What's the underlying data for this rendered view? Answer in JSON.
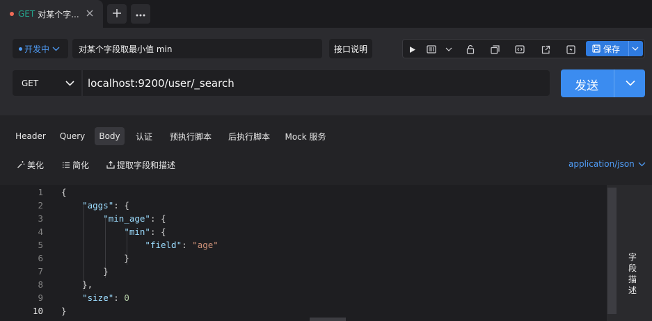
{
  "tab": {
    "method": "GET",
    "title": "对某个字...",
    "method_color": "#25a38c",
    "dot_color": "#f06b57"
  },
  "env": {
    "label": "开发中",
    "color": "#4f9cf6"
  },
  "request": {
    "name": "对某个字段取最小值 min",
    "doc_label": "接口说明",
    "save_label": "保存",
    "method": "GET",
    "url": "localhost:9200/user/_search",
    "send_label": "发送"
  },
  "subtabs": [
    "Header",
    "Query",
    "Body",
    "认证",
    "预执行脚本",
    "后执行脚本",
    "Mock 服务"
  ],
  "active_subtab": "Body",
  "body_tools": {
    "beautify": "美化",
    "simplify": "简化",
    "extract": "提取字段和描述",
    "content_type": "application/json"
  },
  "editor": {
    "line_numbers": [
      "1",
      "2",
      "3",
      "4",
      "5",
      "6",
      "7",
      "8",
      "9",
      "10"
    ],
    "current_line": "10",
    "lines": [
      [
        {
          "t": "p",
          "v": "{"
        }
      ],
      [
        {
          "t": "p",
          "v": "    "
        },
        {
          "t": "k",
          "v": "\"aggs\""
        },
        {
          "t": "p",
          "v": ": {"
        }
      ],
      [
        {
          "t": "p",
          "v": "        "
        },
        {
          "t": "k",
          "v": "\"min_age\""
        },
        {
          "t": "p",
          "v": ": {"
        }
      ],
      [
        {
          "t": "p",
          "v": "            "
        },
        {
          "t": "k",
          "v": "\"min\""
        },
        {
          "t": "p",
          "v": ": {"
        }
      ],
      [
        {
          "t": "p",
          "v": "                "
        },
        {
          "t": "k",
          "v": "\"field\""
        },
        {
          "t": "p",
          "v": ": "
        },
        {
          "t": "s",
          "v": "\"age\""
        }
      ],
      [
        {
          "t": "p",
          "v": "            }"
        }
      ],
      [
        {
          "t": "p",
          "v": "        }"
        }
      ],
      [
        {
          "t": "p",
          "v": "    },"
        }
      ],
      [
        {
          "t": "p",
          "v": "    "
        },
        {
          "t": "k",
          "v": "\"size\""
        },
        {
          "t": "p",
          "v": ": "
        },
        {
          "t": "n",
          "v": "0"
        }
      ],
      [
        {
          "t": "p",
          "v": "}"
        }
      ]
    ]
  },
  "field_desc_label": "字段描述",
  "colors": {
    "accent": "#3b8cf0",
    "save": "#2f7be0",
    "json_key": "#9cdcfe",
    "json_string": "#ce9178",
    "json_number": "#b5cea8"
  },
  "icons": {
    "tab_close": "close-icon",
    "new_tab": "plus-icon",
    "more": "more-icon",
    "run": "play-icon",
    "preview": "document-icon",
    "lock": "lock-icon",
    "copy": "copy-icon",
    "code": "code-icon",
    "share": "share-icon",
    "mock": "lightning-icon",
    "save": "save-icon",
    "beautify": "magic-wand-icon",
    "simplify": "list-icon",
    "extract": "upload-icon"
  }
}
